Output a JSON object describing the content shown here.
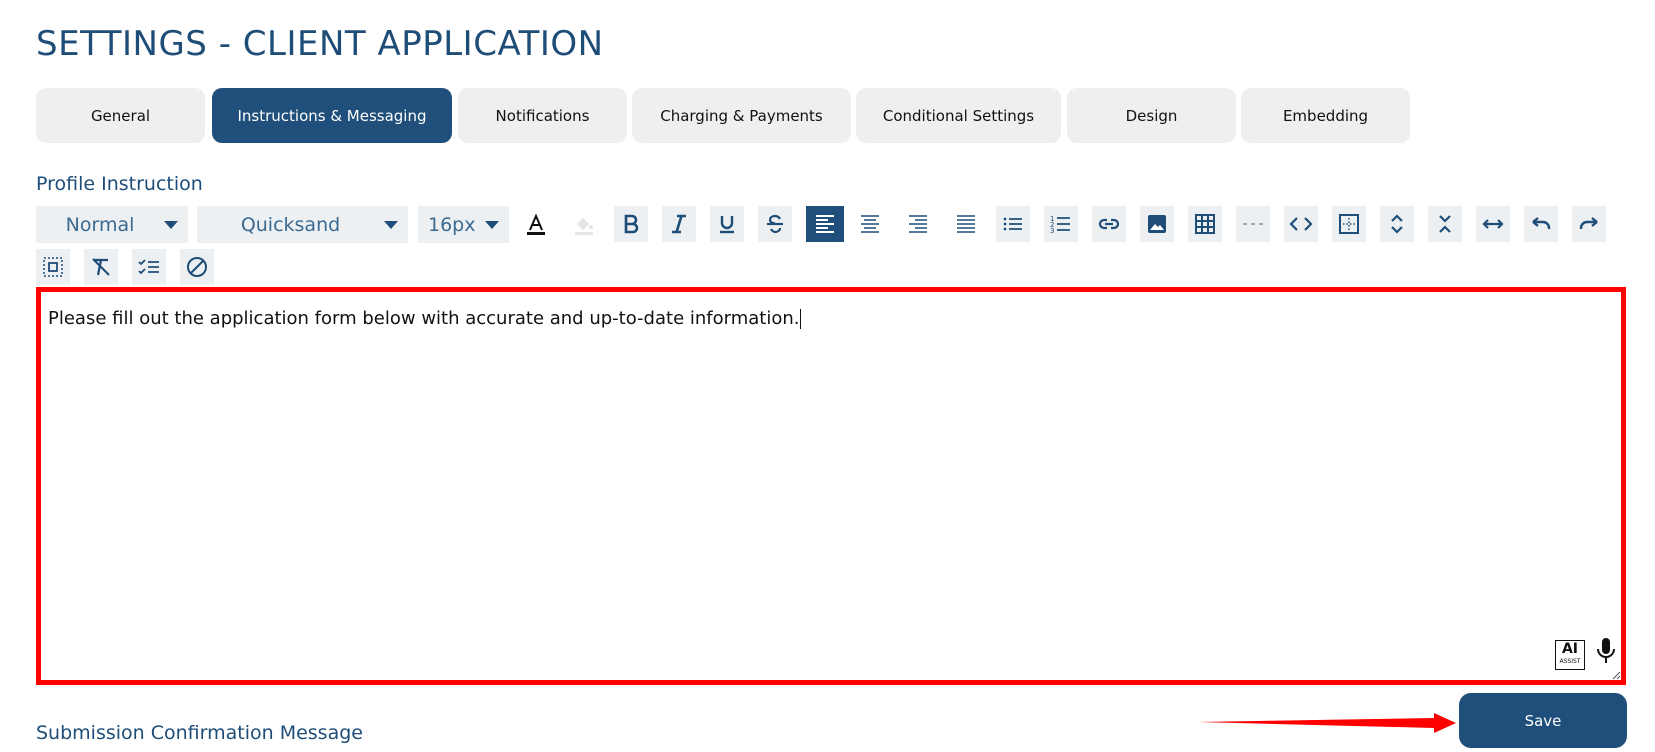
{
  "page": {
    "title": "SETTINGS - CLIENT APPLICATION"
  },
  "tabs": [
    {
      "label": "General",
      "active": false
    },
    {
      "label": "Instructions & Messaging",
      "active": true
    },
    {
      "label": "Notifications",
      "active": false
    },
    {
      "label": "Charging & Payments",
      "active": false
    },
    {
      "label": "Conditional Settings",
      "active": false
    },
    {
      "label": "Design",
      "active": false
    },
    {
      "label": "Embedding",
      "active": false
    }
  ],
  "profile_instruction": {
    "label": "Profile Instruction",
    "toolbar": {
      "block_format": "Normal",
      "font_family": "Quicksand",
      "font_size": "16px",
      "active_alignment": "align-left"
    },
    "content": "Please fill out the application form below with accurate and up-to-date information.",
    "ai_assist": {
      "big": "AI",
      "small": "ASSIST"
    }
  },
  "submission_confirmation": {
    "label": "Submission Confirmation Message"
  },
  "save": {
    "label": "Save"
  },
  "colors": {
    "primary": "#1f4f7a",
    "tab_bg": "#efefef",
    "toolbar_bg": "#edf0f2",
    "highlight": "#ff0000"
  }
}
